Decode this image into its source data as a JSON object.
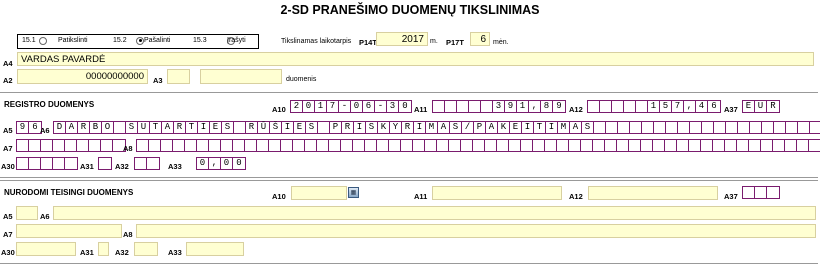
{
  "title": "2-SD PRANEŠIMO DUOMENŲ TIKSLINIMAS",
  "options": [
    {
      "code": "15.1",
      "label": "Patikslinti",
      "selected": false
    },
    {
      "code": "15.2",
      "label": "Pašalinti",
      "selected": true
    },
    {
      "code": "15.3",
      "label": "Įrašyti",
      "selected": false
    }
  ],
  "period": {
    "label": "Tikslinamas laikotarpis",
    "year_code": "P14T",
    "year": "2017",
    "year_unit": "m.",
    "month_code": "P17T",
    "month": "6",
    "month_unit": "mėn."
  },
  "labels": {
    "a4": "A4",
    "a2": "A2",
    "a3": "A3",
    "duomenis": "duomenis",
    "a5": "A5",
    "a6": "A6",
    "a7": "A7",
    "a8": "A8",
    "a30": "A30",
    "a31": "A31",
    "a32": "A32",
    "a33": "A33",
    "a10": "A10",
    "a11": "A11",
    "a12": "A12",
    "a37": "A37"
  },
  "person": {
    "name": "VARDAS PAVARDĖ",
    "code": "00000000000"
  },
  "registry": {
    "heading": "REGISTRO DUOMENYS",
    "a10": "2017-06-30",
    "a11": "391,89",
    "a12": "157,46",
    "a37": "EUR",
    "a5": "96",
    "a6": "DARBO SUTARTIES RŪŠIES PRISKYRIMAS/PAKEITIMAS",
    "a33": "0,00"
  },
  "correct": {
    "heading": "NURODOMI TEISINGI DUOMENYS",
    "calendar_icon": "calendar-icon"
  }
}
